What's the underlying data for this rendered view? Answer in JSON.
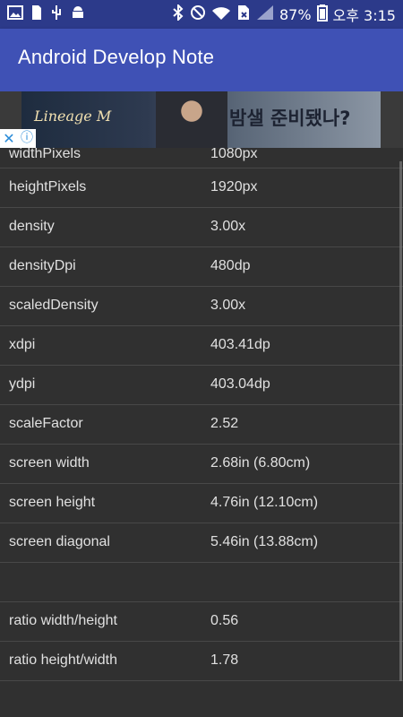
{
  "status_bar": {
    "icons": [
      "image-icon",
      "sim-icon",
      "usb-icon",
      "android-icon",
      "bluetooth-icon",
      "no-disturb-icon",
      "wifi-icon",
      "sim-x-icon",
      "signal-icon",
      "battery-icon"
    ],
    "battery": "87%",
    "time": "오후 3:15"
  },
  "app_bar": {
    "title": "Android Develop Note"
  },
  "ad": {
    "brand": "Lineage M",
    "tagline": "밤샐 준비됐나?",
    "close": "✕",
    "info": "ⓘ"
  },
  "rows": [
    {
      "key": "widthPixels",
      "value": "1080px"
    },
    {
      "key": "heightPixels",
      "value": "1920px"
    },
    {
      "key": "density",
      "value": "3.00x"
    },
    {
      "key": "densityDpi",
      "value": "480dp"
    },
    {
      "key": "scaledDensity",
      "value": "3.00x"
    },
    {
      "key": "xdpi",
      "value": "403.41dp"
    },
    {
      "key": "ydpi",
      "value": "403.04dp"
    },
    {
      "key": "scaleFactor",
      "value": "2.52"
    },
    {
      "key": "screen width",
      "value": "2.68in (6.80cm)"
    },
    {
      "key": "screen height",
      "value": "4.76in (12.10cm)"
    },
    {
      "key": "screen diagonal",
      "value": "5.46in (13.88cm)"
    },
    {
      "key": "",
      "value": ""
    },
    {
      "key": "ratio width/height",
      "value": "0.56"
    },
    {
      "key": "ratio height/width",
      "value": "1.78"
    }
  ]
}
